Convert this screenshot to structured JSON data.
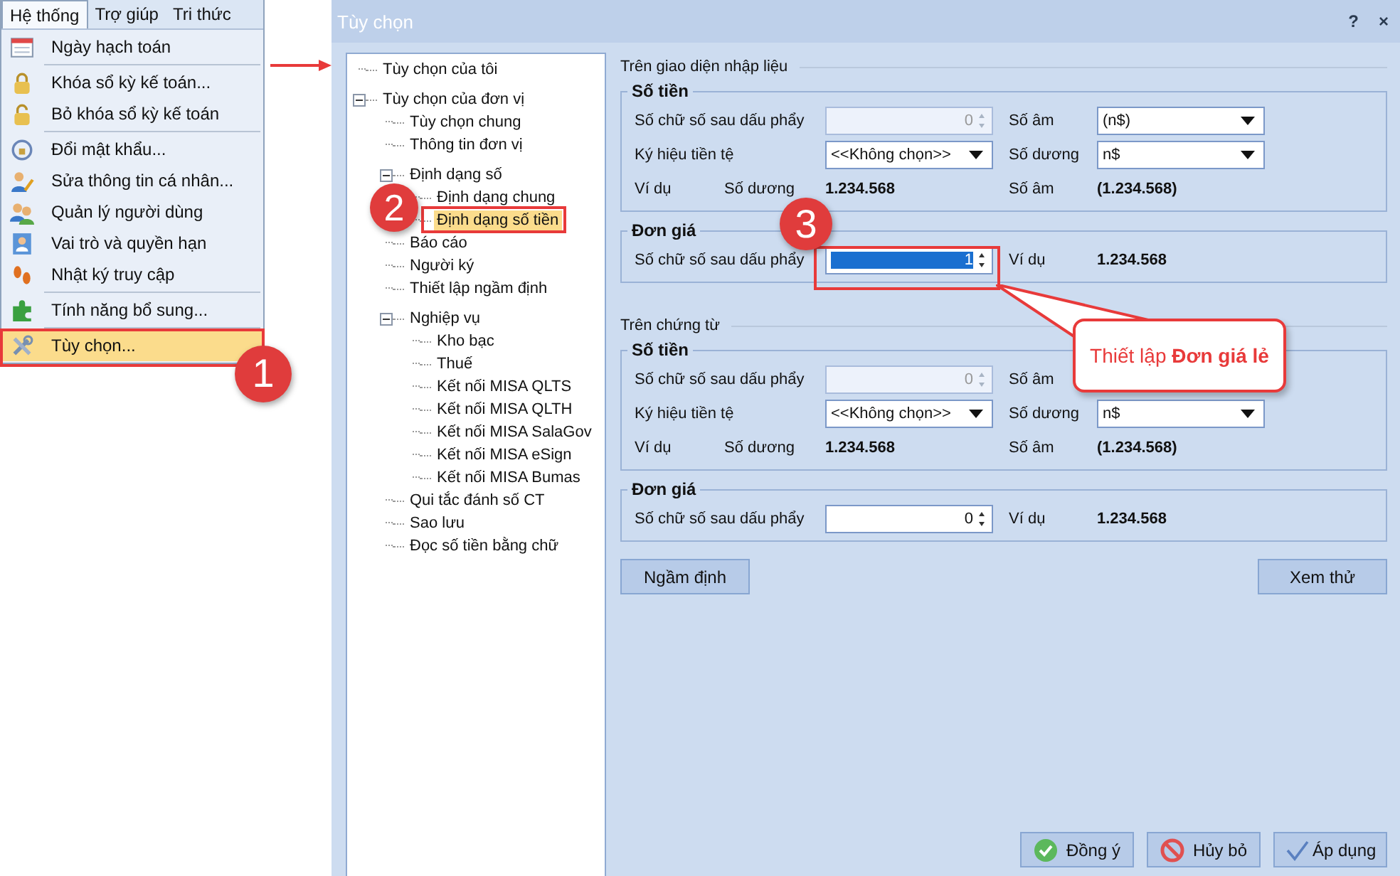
{
  "menu": {
    "bar": [
      {
        "label": "Hệ thống",
        "selected": true
      },
      {
        "label": "Trợ giúp",
        "selected": false
      },
      {
        "label": "Tri thức",
        "selected": false
      }
    ],
    "entries": [
      {
        "label": "Ngày hạch toán",
        "selected": false,
        "separator_after": true
      },
      {
        "label": "Khóa sổ kỳ kế toán...",
        "selected": false,
        "separator_after": false
      },
      {
        "label": "Bỏ khóa sổ kỳ kế toán",
        "selected": false,
        "separator_after": true
      },
      {
        "label": "Đổi mật khẩu...",
        "selected": false,
        "separator_after": false
      },
      {
        "label": "Sửa thông tin cá nhân...",
        "selected": false,
        "separator_after": false
      },
      {
        "label": "Quản lý người dùng",
        "selected": false,
        "separator_after": false
      },
      {
        "label": "Vai trò và quyền hạn",
        "selected": false,
        "separator_after": false
      },
      {
        "label": "Nhật ký truy cập",
        "selected": false,
        "separator_after": true
      },
      {
        "label": "Tính năng bổ sung...",
        "selected": false,
        "separator_after": true
      },
      {
        "label": "Tùy chọn...",
        "selected": true,
        "separator_after": false
      }
    ]
  },
  "dialog": {
    "title": "Tùy chọn",
    "help": "?",
    "close": "×"
  },
  "tree": [
    {
      "label": "Tùy chọn của tôi",
      "selected": false
    },
    {
      "label": "Tùy chọn của đơn vị",
      "selected": false,
      "expanded": true,
      "children": [
        {
          "label": "Tùy chọn chung",
          "selected": false
        },
        {
          "label": "Thông tin đơn vị",
          "selected": false
        },
        {
          "label": "Định dạng số",
          "selected": false,
          "expanded": true,
          "children": [
            {
              "label": "Định dạng chung",
              "selected": false
            },
            {
              "label": "Định dạng số tiền",
              "selected": true
            }
          ]
        },
        {
          "label": "Báo cáo",
          "selected": false
        },
        {
          "label": "Người ký",
          "selected": false
        },
        {
          "label": "Thiết lập ngầm định",
          "selected": false
        },
        {
          "label": "Nghiệp vụ",
          "selected": false,
          "expanded": true,
          "children": [
            {
              "label": "Kho bạc",
              "selected": false
            },
            {
              "label": "Thuế",
              "selected": false
            },
            {
              "label": "Kết nối MISA QLTS",
              "selected": false
            },
            {
              "label": "Kết nối MISA QLTH",
              "selected": false
            },
            {
              "label": "Kết nối MISA SalaGov",
              "selected": false
            },
            {
              "label": "Kết nối MISA eSign",
              "selected": false
            },
            {
              "label": "Kết nối MISA Bumas",
              "selected": false
            }
          ]
        },
        {
          "label": "Qui tắc đánh số CT",
          "selected": false
        },
        {
          "label": "Sao lưu",
          "selected": false
        },
        {
          "label": "Đọc số tiền bằng chữ",
          "selected": false
        }
      ]
    }
  ],
  "sections": [
    {
      "title": "Trên giao diện nhập liệu",
      "groups": [
        {
          "title": "Số tiền",
          "rows": [
            {
              "kind": "fields",
              "cells": [
                {
                  "kind": "label",
                  "text": "Số chữ số sau dấu phẩy"
                },
                {
                  "kind": "spin",
                  "value": "0",
                  "disabled": true,
                  "selected": false
                },
                {
                  "kind": "label",
                  "text": "Số âm"
                },
                {
                  "kind": "combo",
                  "value": "(n$)"
                }
              ]
            },
            {
              "kind": "fields",
              "cells": [
                {
                  "kind": "label",
                  "text": "Ký hiệu tiền tệ"
                },
                {
                  "kind": "combo",
                  "value": "<<Không chọn>>"
                },
                {
                  "kind": "label",
                  "text": "Số dương"
                },
                {
                  "kind": "combo",
                  "value": "n$"
                }
              ]
            },
            {
              "kind": "example",
              "label": "Ví dụ",
              "cells": [
                {
                  "kind": "label",
                  "text": "Số dương"
                },
                {
                  "kind": "value",
                  "text": "1.234.568"
                },
                {
                  "kind": "label",
                  "text": "Số âm"
                },
                {
                  "kind": "value",
                  "text": "(1.234.568)"
                }
              ]
            }
          ]
        },
        {
          "title": "Đơn giá",
          "rows": [
            {
              "kind": "fields",
              "cells": [
                {
                  "kind": "label",
                  "text": "Số chữ số sau dấu phẩy"
                },
                {
                  "kind": "spin",
                  "value": "1",
                  "disabled": false,
                  "selected": true
                },
                {
                  "kind": "label",
                  "text": "Ví dụ"
                },
                {
                  "kind": "value",
                  "text": "1.234.568"
                }
              ]
            }
          ]
        }
      ]
    },
    {
      "title": "Trên chứng từ",
      "groups": [
        {
          "title": "Số tiền",
          "rows": [
            {
              "kind": "fields",
              "cells": [
                {
                  "kind": "label",
                  "text": "Số chữ số sau dấu phẩy"
                },
                {
                  "kind": "spin",
                  "value": "0",
                  "disabled": true,
                  "selected": false
                },
                {
                  "kind": "label",
                  "text": "Số âm"
                }
              ]
            },
            {
              "kind": "fields",
              "cells": [
                {
                  "kind": "label",
                  "text": "Ký hiệu tiền tệ"
                },
                {
                  "kind": "combo",
                  "value": "<<Không chọn>>"
                },
                {
                  "kind": "label",
                  "text": "Số dương"
                },
                {
                  "kind": "combo",
                  "value": "n$"
                }
              ]
            },
            {
              "kind": "example",
              "label": "Ví dụ",
              "cells": [
                {
                  "kind": "label",
                  "text": "Số dương"
                },
                {
                  "kind": "value",
                  "text": "1.234.568"
                },
                {
                  "kind": "label",
                  "text": "Số âm"
                },
                {
                  "kind": "value",
                  "text": "(1.234.568)"
                }
              ]
            }
          ]
        },
        {
          "title": "Đơn giá",
          "rows": [
            {
              "kind": "fields",
              "cells": [
                {
                  "kind": "label",
                  "text": "Số chữ số sau dấu phẩy"
                },
                {
                  "kind": "spin",
                  "value": "0",
                  "disabled": false,
                  "selected": false
                },
                {
                  "kind": "label",
                  "text": "Ví dụ"
                },
                {
                  "kind": "value",
                  "text": "1.234.568"
                }
              ]
            }
          ]
        }
      ]
    }
  ],
  "panel_buttons": [
    "Ngầm định",
    "Xem thử"
  ],
  "footer_buttons": [
    {
      "kind": "ok",
      "label": "Đồng ý"
    },
    {
      "kind": "cancel",
      "label": "Hủy bỏ"
    },
    {
      "kind": "apply",
      "label": "Áp dụng"
    }
  ],
  "annotations": {
    "steps": [
      "1",
      "2",
      "3"
    ],
    "callout": "Thiết lập **Đơn giá lẻ**"
  }
}
